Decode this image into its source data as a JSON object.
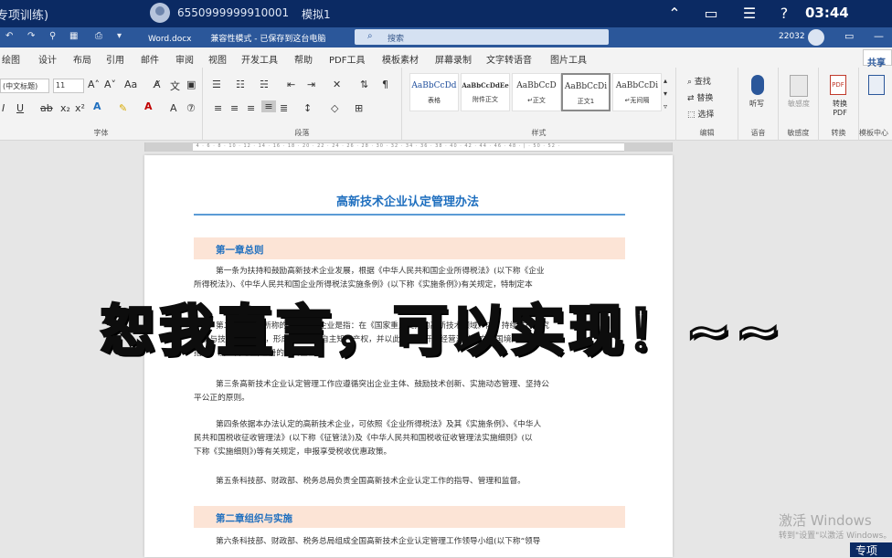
{
  "remote_bar": {
    "title": "专项训练)",
    "user_id": "6550999999910001",
    "session": "模拟1",
    "icons": [
      "collapse-icon",
      "window-icon",
      "list-icon",
      "help-icon"
    ],
    "time": "03:44"
  },
  "word_titlebar": {
    "doc_name": "Word.docx",
    "mode": "兼容性模式 - 已保存到这台电脑",
    "search_placeholder": "搜索",
    "account": "22032"
  },
  "ribbon_tabs": [
    "绘图",
    "设计",
    "布局",
    "引用",
    "邮件",
    "审阅",
    "视图",
    "开发工具",
    "帮助",
    "PDF工具",
    "模板素材",
    "屏幕录制",
    "文字转语音",
    "图片工具"
  ],
  "share_label": "共享",
  "ribbon": {
    "font_name": "(中文标题)",
    "font_size": "11",
    "groups": {
      "font": "字体",
      "paragraph": "段落",
      "styles": "样式",
      "editing": "编辑",
      "voice": "语音",
      "sensitivity": "敏感度",
      "convert": "转换",
      "template": "模板中心"
    },
    "styles": [
      {
        "sample": "AaBbCcDd",
        "name": "表格"
      },
      {
        "sample": "AaBbCcDdEe",
        "name": "附件正文"
      },
      {
        "sample": "AaBbCcD",
        "name": "↵正文"
      },
      {
        "sample": "AaBbCcDi",
        "name": "正文1"
      },
      {
        "sample": "AaBbCcDi",
        "name": "↵无间隔"
      }
    ],
    "editing": {
      "find": "查找",
      "replace": "替换",
      "select": "选择"
    },
    "voice": {
      "dictate": "听写"
    },
    "sensitivity": {
      "label": "敏感度"
    },
    "convert": {
      "label": "转换 PDF"
    }
  },
  "document": {
    "title": "高新技术企业认定管理办法",
    "chapter1": "第一章总则",
    "p1": "第一条为扶持和鼓励高新技术企业发展，根据《中华人民共和国企业所得税法》(以下称《企业\n所得税法》)、《中华人民共和国企业所得税法实施条例》(以下称《实施条例》)有关规定，特制定本",
    "p2": "第二条本办法所称的高新技术企业是指：在《国家重点支持的高新技术领域》内，持续进行研究\n开发与技术成果转化，形成企业核心自主知识产权，并以此为基础开展经营活动，在中国境内(不包\n括港、澳、台地区)注册的居民企业。",
    "p3": "第三条高新技术企业认定管理工作应遵循突出企业主体、鼓励技术创新、实施动态管理、坚持公\n平公正的原则。",
    "p4": "第四条依据本办法认定的高新技术企业，可依照《企业所得税法》及其《实施条例》、《中华人\n民共和国税收征收管理法》(以下称《征管法》)及《中华人民共和国税收征收管理法实施细则》(以\n下称《实施细则》)等有关规定，申报享受税收优惠政策。",
    "p5": "第五条科技部、财政部、税务总局负责全国高新技术企业认定工作的指导、管理和监督。",
    "chapter2": "第二章组织与实施",
    "p6": "第六条科技部、财政部、税务总局组成全国高新技术企业认定管理工作领导小组(以下称“领导"
  },
  "overlay_caption": "恕我直言，可以实现！~~",
  "watermark": {
    "line1": "激活 Windows",
    "line2": "转到\"设置\"以激活 Windows。"
  },
  "corner_text": "专项"
}
